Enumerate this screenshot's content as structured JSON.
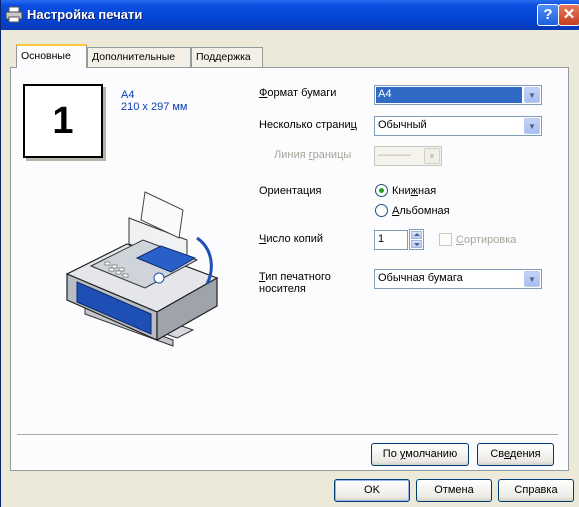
{
  "window": {
    "title": "Настройка печати",
    "help_button": "?",
    "close_button": "✕"
  },
  "tabs": [
    {
      "label": "Основные",
      "active": true
    },
    {
      "label": "Дополнительные",
      "active": false
    },
    {
      "label": "Поддержка",
      "active": false
    }
  ],
  "preview": {
    "page_number": "1",
    "paper_name": "A4",
    "paper_size": "210 x 297 мм"
  },
  "paper_size": {
    "label_u": "Ф",
    "label_rest": "ормат бумаги",
    "value": "A4"
  },
  "multi_page": {
    "label_start": "Несколько страни",
    "label_u": "ц",
    "value": "Обычный"
  },
  "border_line": {
    "label_start": "Линия ",
    "label_u": "г",
    "label_rest": "раницы",
    "value": "———"
  },
  "orientation": {
    "label": "Ориентация",
    "portrait_start": "Кни",
    "portrait_u": "ж",
    "portrait_rest": "ная",
    "landscape_u": "А",
    "landscape_rest": "льбомная",
    "selected": "portrait"
  },
  "copies": {
    "label_u": "Ч",
    "label_rest": "исло копий",
    "value": "1",
    "collate_u": "С",
    "collate_rest": "ортировка"
  },
  "media_type": {
    "label_u": "Т",
    "label_line1_rest": "ип печатного",
    "label_line2": "носителя",
    "value": "Обычная бумага"
  },
  "panel_buttons": {
    "default_start": "По ",
    "default_u": "у",
    "default_rest": "молчанию",
    "about_start": "Св",
    "about_u": "е",
    "about_rest": "дения"
  },
  "dialog_buttons": {
    "ok": "OK",
    "cancel": "Отмена",
    "help": "Справка"
  },
  "colors": {
    "title_bar": "#0646d6",
    "selected_highlight": "#316ac5",
    "accent_link": "#0a40b0",
    "dialog_bg": "#ece9d8"
  }
}
